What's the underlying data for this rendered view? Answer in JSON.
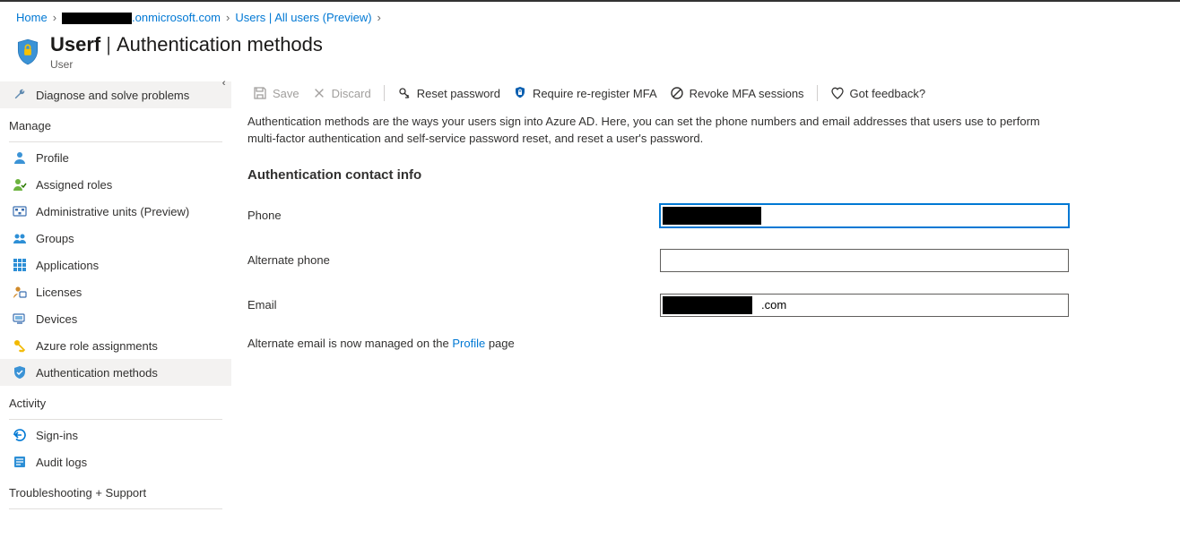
{
  "breadcrumb": {
    "home": "Home",
    "tenant_suffix": ".onmicrosoft.com",
    "users": "Users | All users (Preview)"
  },
  "header": {
    "user_name": "Userf",
    "page_name": "Authentication methods",
    "subtitle": "User"
  },
  "sidebar": {
    "diagnose": "Diagnose and solve problems",
    "sections": {
      "manage": "Manage",
      "activity": "Activity",
      "troubleshoot": "Troubleshooting + Support"
    },
    "manage_items": [
      "Profile",
      "Assigned roles",
      "Administrative units (Preview)",
      "Groups",
      "Applications",
      "Licenses",
      "Devices",
      "Azure role assignments",
      "Authentication methods"
    ],
    "activity_items": [
      "Sign-ins",
      "Audit logs"
    ]
  },
  "commands": {
    "save": "Save",
    "discard": "Discard",
    "reset": "Reset password",
    "require_mfa": "Require re-register MFA",
    "revoke": "Revoke MFA sessions",
    "feedback": "Got feedback?"
  },
  "main": {
    "description": "Authentication methods are the ways your users sign into Azure AD. Here, you can set the phone numbers and email addresses that users use to perform multi-factor authentication and self-service password reset, and reset a user's password.",
    "section_title": "Authentication contact info",
    "labels": {
      "phone": "Phone",
      "alt_phone": "Alternate phone",
      "email": "Email"
    },
    "values": {
      "phone": "",
      "alt_phone": "",
      "email_suffix": ".com"
    },
    "alt_email_note_pre": "Alternate email is now managed on the ",
    "alt_email_link": "Profile",
    "alt_email_note_post": " page"
  },
  "icons": {
    "shield": "shield-lock-icon",
    "wrench": "wrench-icon",
    "person": "person-icon",
    "roles": "person-check-icon",
    "admin_units": "org-icon",
    "groups": "groups-icon",
    "apps": "apps-icon",
    "licenses": "license-icon",
    "devices": "device-icon",
    "rbac": "key-icon",
    "auth": "shield-small-icon",
    "signins": "signin-icon",
    "audit": "log-icon",
    "save": "save-icon",
    "discard": "x-icon",
    "reset_pwd": "key-reset-icon",
    "mfa": "lock-shield-icon",
    "revoke": "block-icon",
    "heart": "heart-icon",
    "collapse": "chevron-left-double-icon"
  },
  "colors": {
    "link": "#0078d4",
    "text": "#323130",
    "muted": "#605e5c",
    "hover_bg": "#f3f2f1"
  }
}
